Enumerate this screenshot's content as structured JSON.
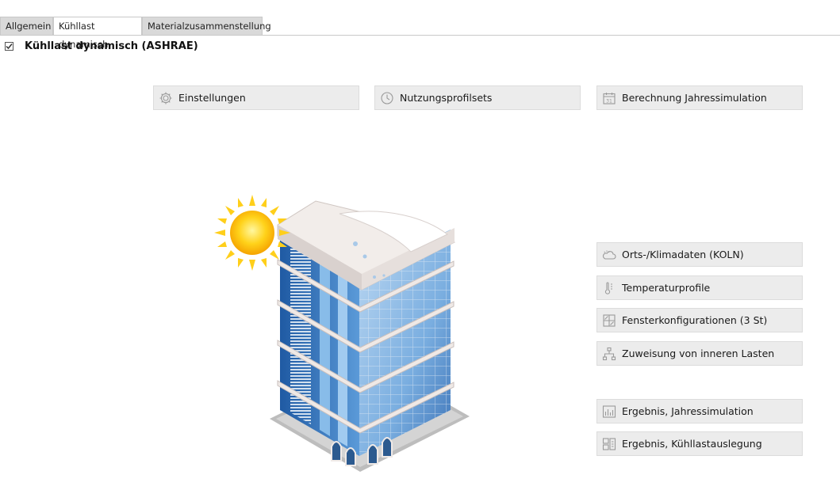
{
  "tabs": [
    {
      "label": "Allgemein",
      "active": false
    },
    {
      "label": "Kühllast dynamisch",
      "active": true
    },
    {
      "label": "Materialzusammenstellung",
      "active": false
    }
  ],
  "section": {
    "title": "Kühllast dynamisch (ASHRAE)",
    "checked": true
  },
  "top_buttons": {
    "settings": {
      "label": "Einstellungen",
      "icon": "gear-icon"
    },
    "usage_profiles": {
      "label": "Nutzungsprofilsets",
      "icon": "clock-icon"
    },
    "annual_simulation": {
      "label": "Berechnung Jahressimulation",
      "icon": "calendar-icon"
    }
  },
  "side_buttons": {
    "location": {
      "label": "Orts-/Klimadaten (KOLN)",
      "icon": "cloud-sun-icon"
    },
    "temperature": {
      "label": "Temperaturprofile",
      "icon": "thermometer-icon"
    },
    "windows": {
      "label": "Fensterkonfigurationen (3 St)",
      "icon": "window-icon"
    },
    "internal_loads": {
      "label": "Zuweisung von inneren Lasten",
      "icon": "tree-structure-icon"
    }
  },
  "result_buttons": {
    "annual_result": {
      "label": "Ergebnis, Jahressimulation",
      "icon": "bar-chart-icon"
    },
    "cooling_load_result": {
      "label": "Ergebnis, Kühllastauslegung",
      "icon": "report-icon"
    }
  },
  "illustration": {
    "subject": "building-with-sun"
  }
}
